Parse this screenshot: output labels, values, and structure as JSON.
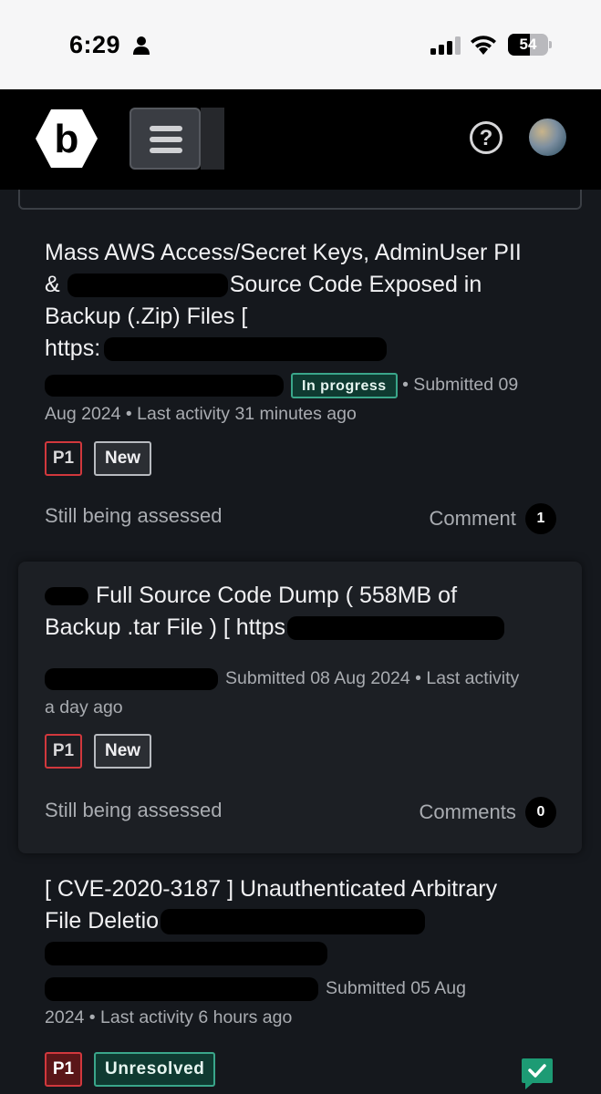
{
  "status_bar": {
    "time": "6:29",
    "battery_level": "54",
    "battery_fraction": 0.54
  },
  "header": {
    "logo_letter": "b",
    "help_symbol": "?"
  },
  "reports": [
    {
      "title_lines": [
        "Mass AWS Access/Secret Keys, AdminUser PII",
        "&",
        "Source Code Exposed in",
        "Backup (.Zip) Files [",
        "https:"
      ],
      "status": "In progress",
      "submitted": "• Submitted 09",
      "submitted_line2": "Aug 2024 • Last activity 31 minutes ago",
      "priority": "P1",
      "state": "New",
      "assessment": "Still being assessed",
      "comments_label": "Comment",
      "comments_count": "1"
    },
    {
      "title_lines": [
        "Full Source Code Dump ( 558MB of",
        "Backup .tar File ) [ https"
      ],
      "submitted": "Submitted 08 Aug 2024 • Last activity",
      "submitted_line2": "a day ago",
      "priority": "P1",
      "state": "New",
      "assessment": "Still being assessed",
      "comments_label": "Comments",
      "comments_count": "0"
    },
    {
      "title_lines": [
        "[ CVE-2020-3187 ] Unauthenticated Arbitrary",
        "File Deletio"
      ],
      "submitted": "Submitted 05 Aug",
      "submitted_line2": "2024 • Last activity 6 hours ago",
      "priority": "P1",
      "state": "Unresolved"
    }
  ],
  "colors": {
    "background": "#15181d",
    "header": "#000000",
    "priority_border": "#d1383d",
    "status_green": "#3aa68a",
    "check_green": "#1d9b74"
  },
  "icons": [
    "person-icon",
    "cellular-signal-icon",
    "wifi-icon",
    "battery-icon",
    "bugcrowd-logo-icon",
    "hamburger-menu-icon",
    "help-circle-icon",
    "user-avatar",
    "checkmark-comment-icon"
  ]
}
